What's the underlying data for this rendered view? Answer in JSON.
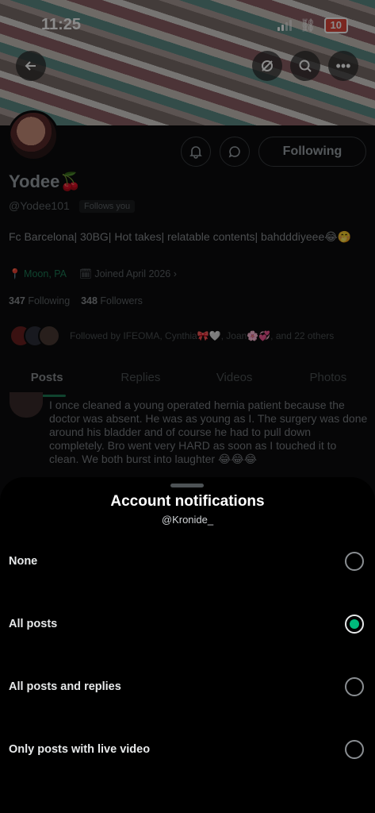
{
  "status_bar": {
    "time": "11:25",
    "battery": "10"
  },
  "profile": {
    "name": "Yodee🍒",
    "handle": "@Yodee101",
    "follows_you": "Follows you",
    "following_button": "Following",
    "bio": "Fc Barcelona| 30BG| Hot takes| relatable contents| bahdddiyeee😂🤭",
    "location": "Moon, PA",
    "joined": "Joined April 2026",
    "following_count": "347",
    "following_label": "Following",
    "followers_count": "348",
    "followers_label": "Followers",
    "followed_by": "Followed by IFEOMA, Cynthia🎀🤍, Joan🌸💞, and 22 others"
  },
  "tabs": [
    "Posts",
    "Replies",
    "Videos",
    "Photos"
  ],
  "post": {
    "text": "I once cleaned a young operated hernia patient because the doctor was absent. He was as young as I. The surgery was done around his bladder and of course he had to pull down completely. Bro went very HARD as soon as I touched it to clean. We both burst into laughter 😂😂😂"
  },
  "sheet": {
    "title": "Account notifications",
    "subtitle": "@Kronide_",
    "options": [
      {
        "label": "None",
        "selected": false
      },
      {
        "label": "All posts",
        "selected": true
      },
      {
        "label": "All posts and replies",
        "selected": false
      },
      {
        "label": "Only posts with live video",
        "selected": false
      }
    ]
  },
  "colors": {
    "accent": "#00ba7c",
    "background": "#000000"
  }
}
